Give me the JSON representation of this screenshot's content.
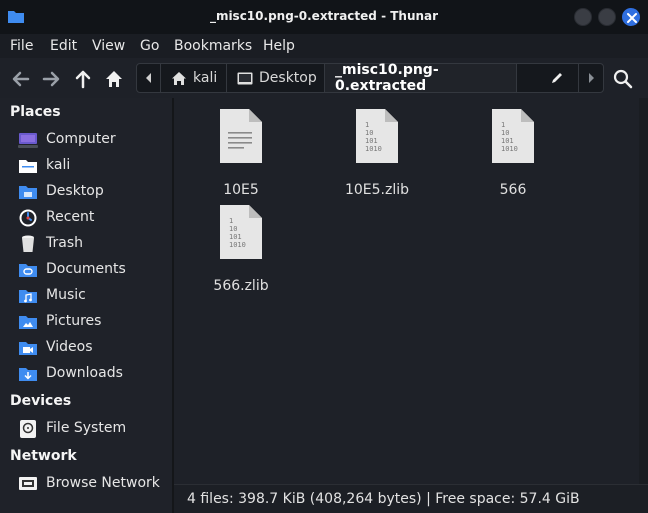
{
  "window": {
    "title": "_misc10.png-0.extracted - Thunar",
    "accent": "#2f6fe0"
  },
  "menu": [
    "File",
    "Edit",
    "View",
    "Go",
    "Bookmarks",
    "Help"
  ],
  "toolbar": {
    "icons": [
      "back-arrow-icon",
      "forward-arrow-icon",
      "up-arrow-icon",
      "home-icon",
      "search-icon"
    ]
  },
  "pathbar": {
    "segments": [
      "kali",
      "Desktop",
      "_misc10.png-0.extracted"
    ]
  },
  "sidebar": {
    "places_header": "Places",
    "places": [
      "Computer",
      "kali",
      "Desktop",
      "Recent",
      "Trash",
      "Documents",
      "Music",
      "Pictures",
      "Videos",
      "Downloads"
    ],
    "devices_header": "Devices",
    "devices": [
      "File System"
    ],
    "network_header": "Network",
    "network": [
      "Browse Network"
    ]
  },
  "files": [
    {
      "name": "10E5",
      "type": "text"
    },
    {
      "name": "10E5.zlib",
      "type": "binary"
    },
    {
      "name": "566",
      "type": "binary"
    },
    {
      "name": "566.zlib",
      "type": "binary"
    }
  ],
  "binary_icon_text": [
    "1",
    "10",
    "101",
    "1010"
  ],
  "status": {
    "text": "4 files: 398.7 KiB (408,264 bytes)  |  Free space: 57.4 GiB"
  }
}
